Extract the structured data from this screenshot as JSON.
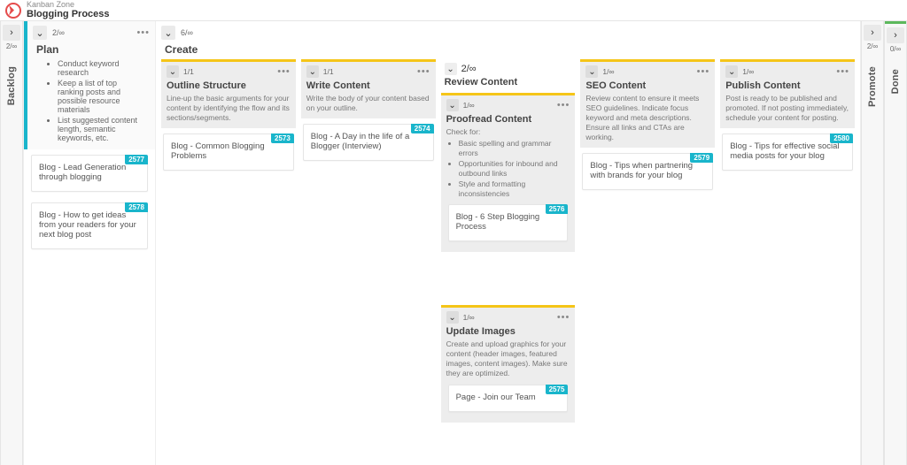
{
  "brand": {
    "small": "Kanban Zone",
    "title": "Blogging Process"
  },
  "collapsed": {
    "backlog": {
      "label": "Backlog",
      "wip": "2/∞"
    },
    "promote": {
      "label": "Promote",
      "wip": "2/∞"
    },
    "done": {
      "label": "Done",
      "wip": "0/∞"
    }
  },
  "plan": {
    "wip": "2/∞",
    "title": "Plan",
    "bullets": [
      "Conduct keyword research",
      "Keep a list of top ranking posts and possible resource materials",
      "List suggested content length, semantic keywords, etc."
    ],
    "cards": [
      {
        "text": "Blog - Lead Generation through blogging",
        "id": "2577"
      },
      {
        "text": "Blog - How to get ideas from your readers for your next blog post",
        "id": "2578"
      }
    ]
  },
  "create": {
    "wip": "6/∞",
    "title": "Create",
    "sub": [
      {
        "wip": "1/1",
        "title": "Outline Structure",
        "desc": "Line-up the basic arguments for your content by identifying the flow and its sections/segments.",
        "cards": [
          {
            "text": "Blog - Common Blogging Problems",
            "id": "2573"
          }
        ]
      },
      {
        "wip": "1/1",
        "title": "Write Content",
        "desc": "Write the body of your content based on your outline.",
        "cards": [
          {
            "text": "Blog - A Day in the life of a Blogger (Interview)",
            "id": "2574"
          }
        ]
      },
      {
        "type": "review",
        "wip": "2/∞",
        "title": "Review Content",
        "children": [
          {
            "wip": "1/∞",
            "title": "Proofread Content",
            "desc_lead": "Check for:",
            "bullets": [
              "Basic spelling and grammar errors",
              "Opportunities for inbound and outbound links",
              "Style and formatting inconsistencies"
            ],
            "cards": [
              {
                "text": "Blog - 6 Step Blogging Process",
                "id": "2576"
              }
            ]
          },
          {
            "wip": "1/∞",
            "title": "Update Images",
            "desc": "Create and upload graphics for your content (header images, featured images, content images). Make sure they are optimized.",
            "cards": [
              {
                "text": "Page - Join our Team",
                "id": "2575"
              }
            ]
          }
        ]
      },
      {
        "wip": "1/∞",
        "title": "SEO Content",
        "desc": "Review content to ensure it meets SEO guidelines. Indicate focus keyword and meta descriptions. Ensure all links and CTAs are working.",
        "cards": [
          {
            "text": "Blog - Tips when partnering with brands for your blog",
            "id": "2579"
          }
        ]
      },
      {
        "wip": "1/∞",
        "title": "Publish Content",
        "desc": "Post is ready to be published and promoted. If not posting immediately, schedule your content for posting.",
        "cards": [
          {
            "text": "Blog - Tips for effective social media posts for your blog",
            "id": "2580"
          }
        ]
      }
    ]
  }
}
